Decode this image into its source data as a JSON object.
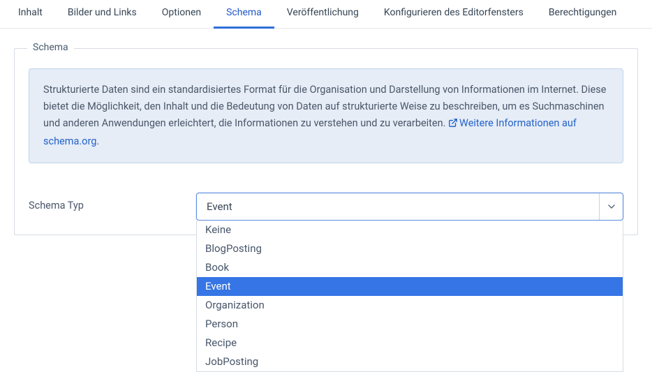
{
  "tabs": [
    {
      "label": "Inhalt",
      "active": false
    },
    {
      "label": "Bilder und Links",
      "active": false
    },
    {
      "label": "Optionen",
      "active": false
    },
    {
      "label": "Schema",
      "active": true
    },
    {
      "label": "Veröffentlichung",
      "active": false
    },
    {
      "label": "Konfigurieren des Editorfensters",
      "active": false
    },
    {
      "label": "Berechtigungen",
      "active": false
    }
  ],
  "fieldset": {
    "legend": "Schema"
  },
  "info": {
    "text": "Strukturierte Daten sind ein standardisiertes Format für die Organisation und Darstellung von Informationen im Internet. Diese bietet die Möglichkeit, den Inhalt und die Bedeutung von Daten auf strukturierte Weise zu beschreiben, um es Suchmaschinen und anderen Anwendungen erleichtert, die Informationen zu verstehen und zu verarbeiten. ",
    "link_text": "Weitere Informationen auf schema.org",
    "period": "."
  },
  "field": {
    "label": "Schema Typ",
    "value": "Event",
    "options": [
      "Keine",
      "BlogPosting",
      "Book",
      "Event",
      "Organization",
      "Person",
      "Recipe",
      "JobPosting"
    ],
    "selected_index": 3
  }
}
